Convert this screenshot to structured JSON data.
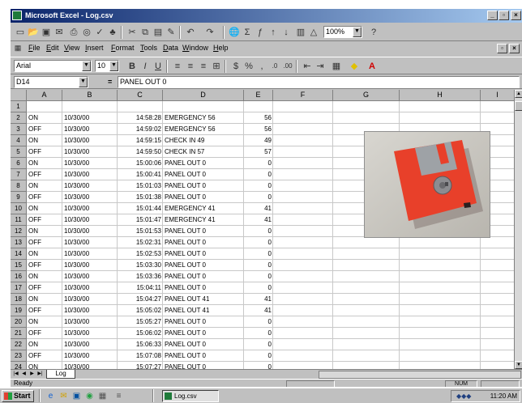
{
  "window": {
    "title": "Microsoft Excel - Log.csv",
    "icons": [
      "excel-app-icon",
      "minimize-icon",
      "restore-icon",
      "close-icon"
    ]
  },
  "toolbar_standard": {
    "zoom": "100%",
    "icons": [
      "new-icon",
      "open-icon",
      "save-icon",
      "email-icon",
      "print-icon",
      "print-preview-icon",
      "spelling-icon",
      "research-icon",
      "cut-icon",
      "copy-icon",
      "paste-icon",
      "format-painter-icon",
      "undo-icon",
      "redo-icon",
      "hyperlink-icon",
      "autosum-icon",
      "paste-function-icon",
      "sort-ascending-icon",
      "sort-descending-icon",
      "chart-wizard-icon",
      "drawing-icon",
      "help-icon"
    ]
  },
  "menubar": {
    "items": [
      "File",
      "Edit",
      "View",
      "Insert",
      "Format",
      "Tools",
      "Data",
      "Window",
      "Help"
    ]
  },
  "toolbar_formatting": {
    "font": "Arial",
    "size": "10",
    "buttons": [
      "B",
      "I",
      "U"
    ],
    "icons": [
      "align-left-icon",
      "center-icon",
      "align-right-icon",
      "merge-center-icon",
      "currency-icon",
      "percent-icon",
      "comma-icon",
      "increase-decimal-icon",
      "decrease-decimal-icon",
      "decrease-indent-icon",
      "increase-indent-icon",
      "borders-icon",
      "fill-color-icon",
      "font-color-icon"
    ]
  },
  "formula_bar": {
    "name_box": "D14",
    "equals": "=",
    "content": "PANEL OUT 0"
  },
  "sheet": {
    "columns": [
      "A",
      "B",
      "C",
      "D",
      "E",
      "F",
      "G",
      "H",
      "I"
    ],
    "row_numbers": [
      "1",
      "2",
      "3",
      "4",
      "5",
      "6",
      "7",
      "8",
      "9",
      "10",
      "11",
      "12",
      "13",
      "14",
      "15",
      "16",
      "17",
      "18",
      "19",
      "20",
      "21",
      "22",
      "23",
      "24"
    ],
    "rows": [
      [
        "",
        "",
        "",
        "",
        ""
      ],
      [
        "ON",
        "10/30/00",
        "14:58:28",
        "EMERGENCY 56",
        "56"
      ],
      [
        "OFF",
        "10/30/00",
        "14:59:02",
        "EMERGENCY 56",
        "56"
      ],
      [
        "ON",
        "10/30/00",
        "14:59:15",
        "CHECK IN 49",
        "49"
      ],
      [
        "OFF",
        "10/30/00",
        "14:59:50",
        "CHECK IN 57",
        "57"
      ],
      [
        "ON",
        "10/30/00",
        "15:00:06",
        "PANEL OUT 0",
        "0"
      ],
      [
        "OFF",
        "10/30/00",
        "15:00:41",
        "PANEL OUT 0",
        "0"
      ],
      [
        "ON",
        "10/30/00",
        "15:01:03",
        "PANEL OUT 0",
        "0"
      ],
      [
        "OFF",
        "10/30/00",
        "15:01:38",
        "PANEL OUT 0",
        "0"
      ],
      [
        "ON",
        "10/30/00",
        "15:01:44",
        "EMERGENCY 41",
        "41"
      ],
      [
        "OFF",
        "10/30/00",
        "15:01:47",
        "EMERGENCY 41",
        "41"
      ],
      [
        "ON",
        "10/30/00",
        "15:01:53",
        "PANEL OUT 0",
        "0"
      ],
      [
        "OFF",
        "10/30/00",
        "15:02:31",
        "PANEL OUT 0",
        "0"
      ],
      [
        "ON",
        "10/30/00",
        "15:02:53",
        "PANEL OUT 0",
        "0"
      ],
      [
        "OFF",
        "10/30/00",
        "15:03:30",
        "PANEL OUT 0",
        "0"
      ],
      [
        "ON",
        "10/30/00",
        "15:03:36",
        "PANEL OUT 0",
        "0"
      ],
      [
        "OFF",
        "10/30/00",
        "15:04:11",
        "PANEL OUT 0",
        "0"
      ],
      [
        "ON",
        "10/30/00",
        "15:04:27",
        "PANEL OUT 41",
        "41"
      ],
      [
        "OFF",
        "10/30/00",
        "15:05:02",
        "PANEL OUT 41",
        "41"
      ],
      [
        "ON",
        "10/30/00",
        "15:05:27",
        "PANEL OUT 0",
        "0"
      ],
      [
        "OFF",
        "10/30/00",
        "15:06:02",
        "PANEL OUT 0",
        "0"
      ],
      [
        "ON",
        "10/30/00",
        "15:06:33",
        "PANEL OUT 0",
        "0"
      ],
      [
        "OFF",
        "10/30/00",
        "15:07:08",
        "PANEL OUT 0",
        "0"
      ],
      [
        "ON",
        "10/30/00",
        "15:07:27",
        "PANEL OUT 0",
        "0"
      ]
    ]
  },
  "sheet_tab": "Log",
  "status": {
    "ready": "Ready",
    "num": "NUM"
  },
  "taskbar": {
    "start": "Start",
    "task": "Log.csv",
    "clock": "11:20 AM",
    "icons": [
      "windows-flag-icon",
      "ie-icon",
      "outlook-icon",
      "desktop-icon",
      "channels-icon",
      "excel-task-icon",
      "tray-speaker-icon"
    ]
  },
  "colors": {
    "title_start": "#0a246a",
    "title_end": "#a6caf0",
    "chrome": "#c0c0c0",
    "floppy": "#e8402a"
  }
}
